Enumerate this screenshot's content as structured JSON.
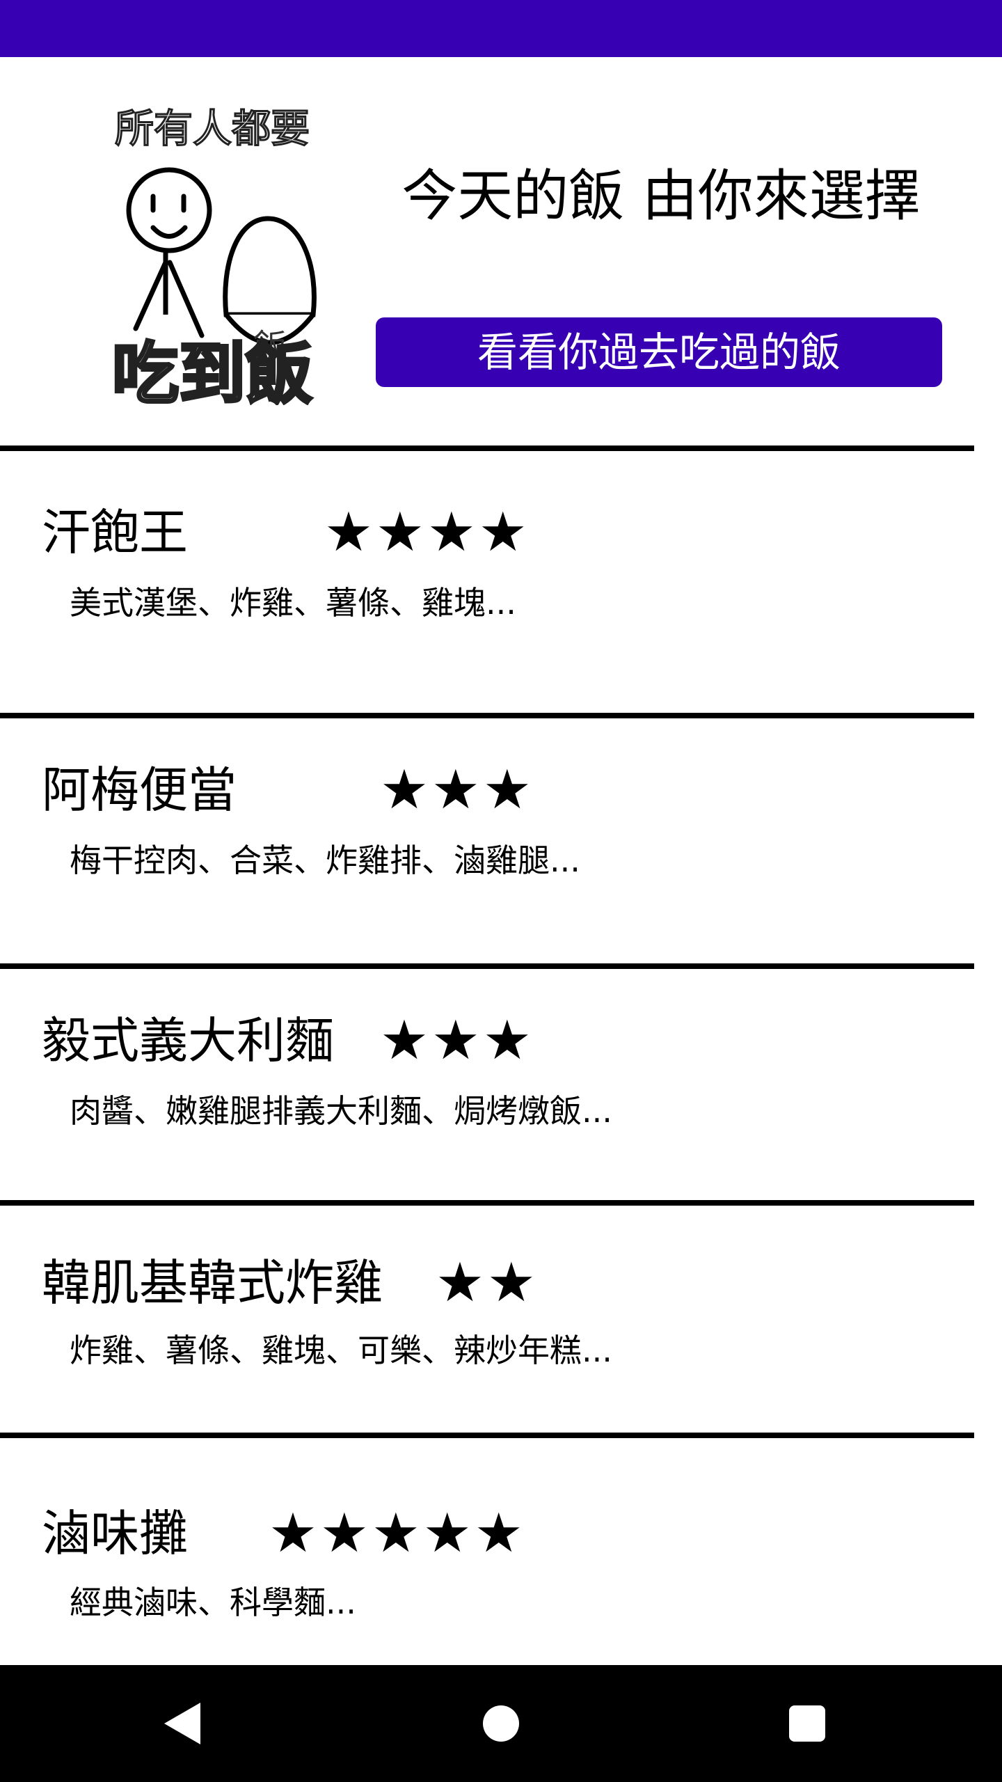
{
  "header": {
    "logo": {
      "top_text": "所有人都要",
      "rice_label": "飯",
      "bottom_text": "吃到飯"
    },
    "title": "今天的飯 由你來選擇",
    "history_button_label": "看看你過去吃過的飯"
  },
  "restaurants": [
    {
      "name": "汗飽王",
      "rating_stars": 4,
      "rating": "★★★★",
      "description": "美式漢堡、炸雞、薯條、雞塊..."
    },
    {
      "name": "阿梅便當",
      "rating_stars": 3,
      "rating": "★★★",
      "description": "梅干控肉、合菜、炸雞排、滷雞腿..."
    },
    {
      "name": "毅式義大利麵",
      "rating_stars": 3,
      "rating": "★★★",
      "description": "肉醬、嫩雞腿排義大利麵、焗烤燉飯..."
    },
    {
      "name": "韓肌基韓式炸雞",
      "rating_stars": 2,
      "rating": "★★",
      "description": "炸雞、薯條、雞塊、可樂、辣炒年糕..."
    },
    {
      "name": "滷味攤",
      "rating_stars": 5,
      "rating": "★★★★★",
      "description": "經典滷味、科學麵..."
    }
  ],
  "nav": {
    "back_icon": "back-triangle-icon",
    "home_icon": "home-circle-icon",
    "recents_icon": "recents-square-icon"
  },
  "colors": {
    "accent": "#3700b3",
    "nav_background": "#000000",
    "divider": "#000000"
  }
}
